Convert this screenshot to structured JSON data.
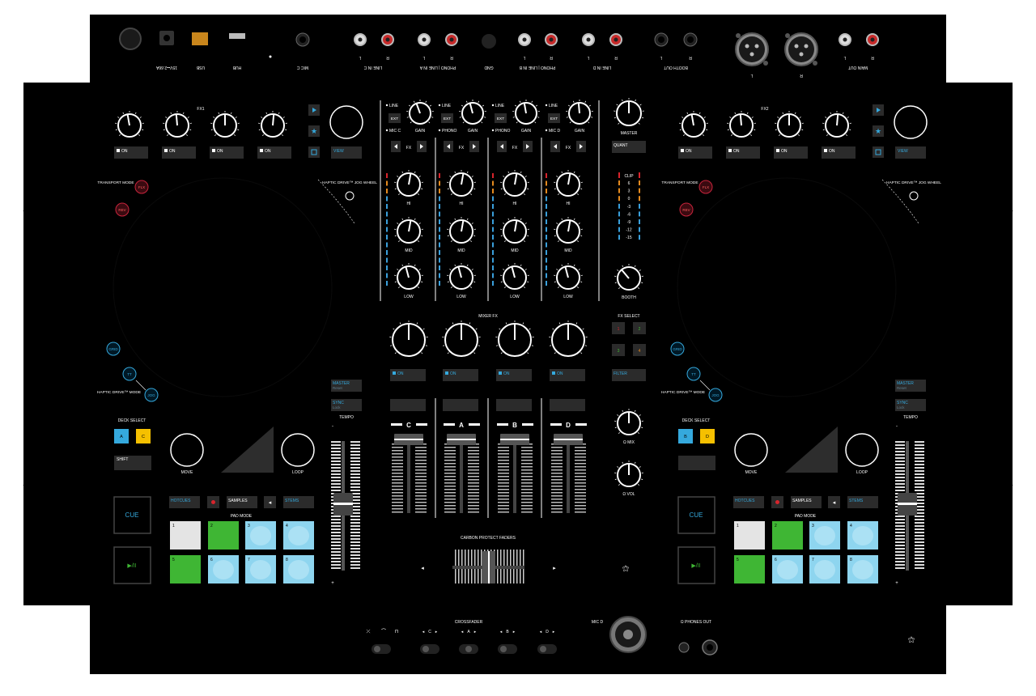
{
  "colors": {
    "body": "#000000",
    "button": "#2b2b2b",
    "cyan": "#35a9dd",
    "red": "#d8242c",
    "yellow": "#f5c000",
    "pad_white": "#e4e4e4",
    "pad_green": "#3fb634",
    "pad_blue": "#8ed5ef",
    "meter_red": "#d8242c",
    "meter_orange": "#e58a1e",
    "meter_blue": "#3aa0dc"
  },
  "rear_panel": {
    "labels": [
      "15V⎓2.66A",
      "USB",
      "HUB",
      "MIC C",
      "LINE IN C",
      "PHONO | LINE IN A",
      "GND",
      "PHONO | LINE IN B",
      "LINE IN D",
      "BOOTH OUT",
      "MAIN OUT"
    ],
    "channel_letters": [
      "L",
      "R",
      "L",
      "R",
      "L",
      "R",
      "L",
      "R",
      "L",
      "R",
      "L",
      "R",
      "L",
      "R"
    ]
  },
  "decks": [
    {
      "fx_label": "FX1",
      "on_labels": [
        "ON",
        "ON",
        "ON",
        "ON"
      ],
      "view_label": "VIEW",
      "transport_mode": "TRANSPORT MODE",
      "flx": "FLX",
      "rev": "REV",
      "haptic_drive": "HAPTIC DRIVE™ JOG WHEEL",
      "grid": "GRID",
      "tt": "TT",
      "jog": "JOG",
      "haptic_mode": "HAPTIC DRIVE™ MODE",
      "deck_select": "DECK SELECT",
      "deck_a": "A",
      "deck_b": "C",
      "shift": "SHIFT",
      "move": "MOVE",
      "loop": "LOOP",
      "master": "MASTER",
      "master_sub": "Reset",
      "sync": "SYNC",
      "sync_sub": "Lock",
      "tempo": "TEMPO",
      "cue": "CUE",
      "play": "▶/II",
      "hotcues": "HOTCUES",
      "samples": "SAMPLES",
      "stems": "STEMS",
      "pad_mode": "PAD MODE",
      "pads": [
        "1",
        "2",
        "3",
        "4",
        "5",
        "6",
        "7",
        "8"
      ]
    },
    {
      "fx_label": "FX2",
      "on_labels": [
        "ON",
        "ON",
        "ON",
        "ON"
      ],
      "view_label": "VIEW",
      "transport_mode": "TRANSPORT MODE",
      "flx": "FLX",
      "rev": "REV",
      "haptic_drive": "HAPTIC DRIVE™ JOG WHEEL",
      "grid": "GRID",
      "tt": "TT",
      "jog": "JOG",
      "haptic_mode": "HAPTIC DRIVE™ MODE",
      "deck_select": "DECK SELECT",
      "deck_a": "B",
      "deck_b": "D",
      "shift": "",
      "move": "MOVE",
      "loop": "LOOP",
      "master": "MASTER",
      "master_sub": "Reset",
      "sync": "SYNC",
      "sync_sub": "Lock",
      "tempo": "TEMPO",
      "cue": "CUE",
      "play": "▶/II",
      "hotcues": "HOTCUES",
      "samples": "SAMPLES",
      "stems": "STEMS",
      "pad_mode": "PAD MODE",
      "pads": [
        "1",
        "2",
        "3",
        "4",
        "5",
        "6",
        "7",
        "8"
      ]
    }
  ],
  "mixer": {
    "channels": [
      {
        "top": "LINE",
        "mid": "EXT",
        "bottom": "MIC C",
        "gain": "GAIN",
        "fx": "FX",
        "letter": "C",
        "on": "ON"
      },
      {
        "top": "LINE",
        "mid": "EXT",
        "bottom": "PHONO",
        "gain": "GAIN",
        "fx": "FX",
        "letter": "A",
        "on": "ON"
      },
      {
        "top": "LINE",
        "mid": "EXT",
        "bottom": "PHONO",
        "gain": "GAIN",
        "fx": "FX",
        "letter": "B",
        "on": "ON"
      },
      {
        "top": "LINE",
        "mid": "EXT",
        "bottom": "MIC D",
        "gain": "GAIN",
        "fx": "FX",
        "letter": "D",
        "on": "ON"
      }
    ],
    "eq": [
      "HI",
      "MID",
      "LOW"
    ],
    "master": "MASTER",
    "quant": "QUANT",
    "clip": "CLIP",
    "meter_labels": [
      "6",
      "3",
      "0",
      "-3",
      "-6",
      "-9",
      "-12",
      "-15"
    ],
    "booth": "BOOTH",
    "mixer_fx": "MIXER FX",
    "fx_select": "FX SELECT",
    "fx_buttons": [
      "1",
      "2",
      "3",
      "4"
    ],
    "filter": "FILTER",
    "mix": "Ω MIX",
    "vol": "Ω VOL",
    "carbon": "CARBON PROTECT FADERS",
    "crossfader": "CROSSFADER",
    "xf_assign": [
      "C",
      "A",
      "B",
      "D"
    ],
    "mic_d": "MIC D",
    "phones_out": "Ω PHONES OUT"
  }
}
